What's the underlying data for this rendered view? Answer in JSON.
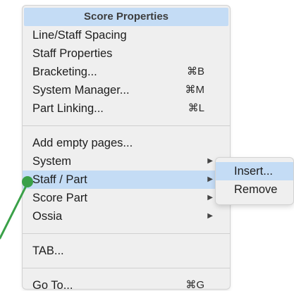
{
  "menu": {
    "header": "Score Properties",
    "group1": [
      {
        "label": "Line/Staff Spacing",
        "shortcut": ""
      },
      {
        "label": "Staff Properties",
        "shortcut": ""
      },
      {
        "label": "Bracketing...",
        "shortcut": "⌘B"
      },
      {
        "label": "System Manager...",
        "shortcut": "⌘M"
      },
      {
        "label": "Part Linking...",
        "shortcut": "⌘L"
      }
    ],
    "group2": [
      {
        "label": "Add empty pages...",
        "submenu": false
      },
      {
        "label": "System",
        "submenu": true
      },
      {
        "label": "Staff / Part",
        "submenu": true,
        "highlighted": true
      },
      {
        "label": "Score Part",
        "submenu": true
      },
      {
        "label": "Ossia",
        "submenu": true
      }
    ],
    "group3": [
      {
        "label": "TAB..."
      }
    ],
    "group4": [
      {
        "label": "Go To...",
        "shortcut": "⌘G"
      }
    ],
    "submenu_arrow": "▶"
  },
  "submenu": {
    "items": [
      {
        "label": "Insert...",
        "highlighted": true
      },
      {
        "label": "Remove",
        "highlighted": false
      }
    ]
  },
  "colors": {
    "menu_bg": "#efefef",
    "highlight": "#c4dcf5",
    "annotation": "#3aa048"
  },
  "icons": {
    "annotation_pointer": "green-dot-pointer-icon",
    "submenu_arrow": "triangle-right-icon"
  }
}
